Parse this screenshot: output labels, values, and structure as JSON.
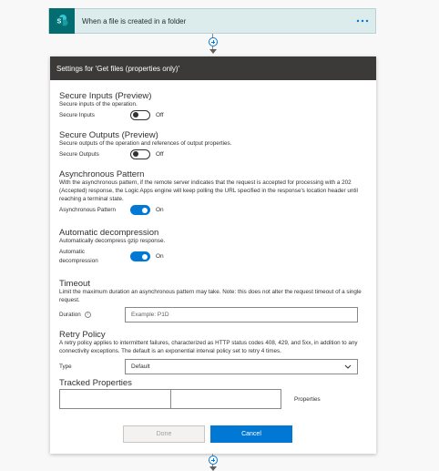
{
  "trigger": {
    "title": "When a file is created in a folder",
    "more_icon": "ellipsis-icon"
  },
  "panel": {
    "header": "Settings for 'Get files (properties only)'",
    "secure_inputs": {
      "heading": "Secure Inputs (Preview)",
      "description": "Secure inputs of the operation.",
      "label": "Secure Inputs",
      "state": "Off"
    },
    "secure_outputs": {
      "heading": "Secure Outputs (Preview)",
      "description": "Secure outputs of the operation and references of output properties.",
      "label": "Secure Outputs",
      "state": "Off"
    },
    "async": {
      "heading": "Asynchronous Pattern",
      "description": "With the asynchronous pattern, if the remote server indicates that the request is accepted for processing with a 202 (Accepted) response, the Logic Apps engine will keep polling the URL specified in the response's location header until reaching a terminal state.",
      "label": "Asynchronous Pattern",
      "state": "On"
    },
    "decompression": {
      "heading": "Automatic decompression",
      "description": "Automatically decompress gzip response.",
      "label_line1": "Automatic",
      "label_line2": "decompression",
      "state": "On"
    },
    "timeout": {
      "heading": "Timeout",
      "description": "Limit the maximum duration an asynchronous pattern may take. Note: this does not alter the request timeout of a single request.",
      "label": "Duration",
      "placeholder": "Example: P1D"
    },
    "retry": {
      "heading": "Retry Policy",
      "description": "A retry policy applies to intermittent failures, characterized as HTTP status codes 408, 429, and 5xx, in addition to any connectivity exceptions. The default is an exponential interval policy set to retry 4 times.",
      "label": "Type",
      "value": "Default"
    },
    "tracked": {
      "heading": "Tracked Properties",
      "side_label": "Properties"
    },
    "buttons": {
      "done": "Done",
      "cancel": "Cancel"
    }
  }
}
